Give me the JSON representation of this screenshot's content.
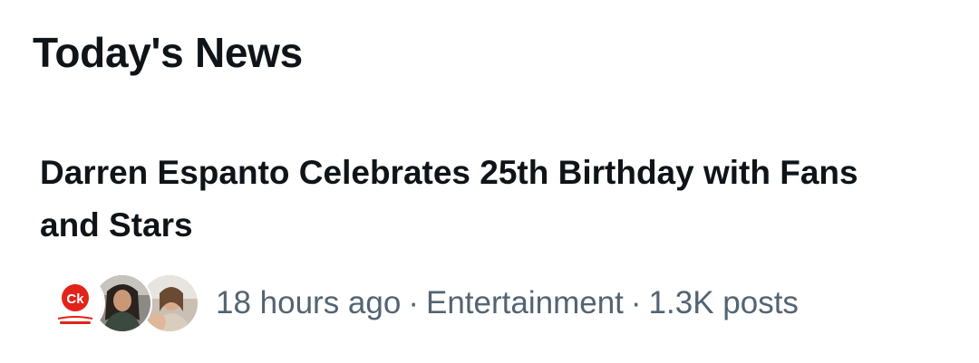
{
  "section": {
    "title": "Today's News"
  },
  "news_item": {
    "headline": "Darren Espanto Celebrates 25th Birthday with Fans and Stars",
    "time": "18 hours ago",
    "category": "Entertainment",
    "posts": "1.3K posts",
    "separator": "·",
    "avatars": [
      {
        "icon": "ck-logo-avatar",
        "logo_text": "Ck"
      },
      {
        "icon": "person-avatar"
      },
      {
        "icon": "person-avatar"
      }
    ]
  },
  "colors": {
    "text_primary": "#0f1419",
    "text_secondary": "#536471",
    "logo_red": "#e2231a"
  }
}
